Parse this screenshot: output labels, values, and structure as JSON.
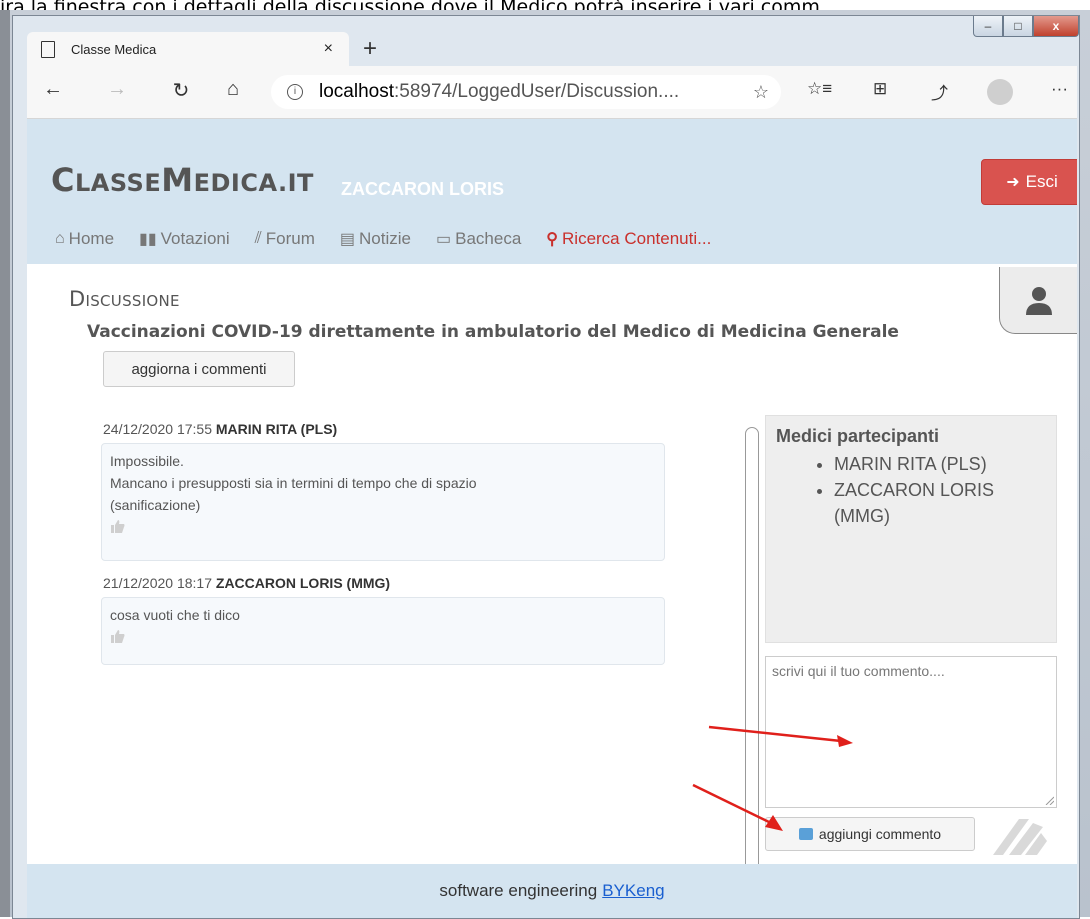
{
  "doc_text": "ira la finestra con i dettagli della discussione dove il Medico potrà inserire i vari comm",
  "window_controls": {
    "min": "–",
    "max": "□",
    "close": "x"
  },
  "tab": {
    "title": "Classe Medica",
    "close": "×",
    "new_tab": "+"
  },
  "address": {
    "info": "i",
    "host": "localhost",
    "path": ":58974/LoggedUser/Discussion...."
  },
  "site": {
    "brand_c": "C",
    "brand_lasse": "LASSE",
    "brand_m": "M",
    "brand_edica": "EDICA.IT",
    "user": "ZACCARON LORIS",
    "exit_label": "Esci",
    "nav": [
      {
        "label": "Home",
        "icon": "home-icon"
      },
      {
        "label": "Votazioni",
        "icon": "votes-icon"
      },
      {
        "label": "Forum",
        "icon": "forum-icon"
      },
      {
        "label": "Notizie",
        "icon": "news-icon"
      },
      {
        "label": "Bacheca",
        "icon": "board-icon"
      },
      {
        "label": "Ricerca Contenuti...",
        "icon": "search-icon"
      }
    ]
  },
  "discussion": {
    "heading": "Discussione",
    "subject": "Vaccinazioni COVID-19 direttamente in ambulatorio del Medico di Medicina Generale",
    "refresh_label": "aggiorna i commenti",
    "comments": [
      {
        "datetime": "24/12/2020 17:55",
        "author": "MARIN RITA (PLS)",
        "lines": [
          "Impossibile.",
          "Mancano i presupposti sia in termini di tempo che di spazio",
          "(sanificazione)"
        ]
      },
      {
        "datetime": "21/12/2020 18:17",
        "author": "ZACCARON LORIS (MMG)",
        "lines": [
          "cosa vuoti che ti dico"
        ]
      }
    ],
    "participants_title": "Medici partecipanti",
    "participants": [
      "MARIN RITA (PLS)",
      "ZACCARON LORIS",
      "(MMG)"
    ],
    "comment_placeholder": "scrivi qui il tuo commento....",
    "add_comment_label": "aggiungi commento"
  },
  "footer": {
    "text": "software engineering",
    "link": "BYKeng"
  },
  "colors": {
    "header_bg": "#d4e4f0",
    "exit_btn": "#d9534f",
    "search_nav": "#c9302c",
    "annotation_arrow": "#e0201b"
  }
}
